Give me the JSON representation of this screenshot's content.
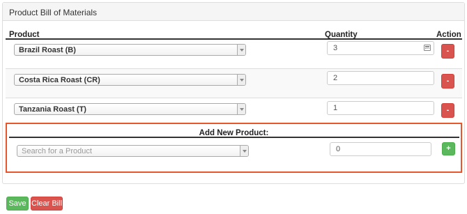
{
  "panel": {
    "title": "Product Bill of Materials"
  },
  "table": {
    "headers": {
      "product": "Product",
      "quantity": "Quantity",
      "action": "Action"
    },
    "rows": [
      {
        "product": "Brazil Roast (B)",
        "quantity": "3",
        "remove_label": "-"
      },
      {
        "product": "Costa Rica Roast (CR)",
        "quantity": "2",
        "remove_label": "-"
      },
      {
        "product": "Tanzania Roast (T)",
        "quantity": "1",
        "remove_label": "-"
      }
    ]
  },
  "add_new": {
    "title": "Add New Product:",
    "search_placeholder": "Search for a Product",
    "quantity": "0",
    "add_label": "+"
  },
  "footer": {
    "save_label": "Save",
    "clear_label": "Clear Bill"
  },
  "colors": {
    "danger": "#d9534f",
    "success": "#5cb85c",
    "highlight_border": "#e8562b"
  }
}
